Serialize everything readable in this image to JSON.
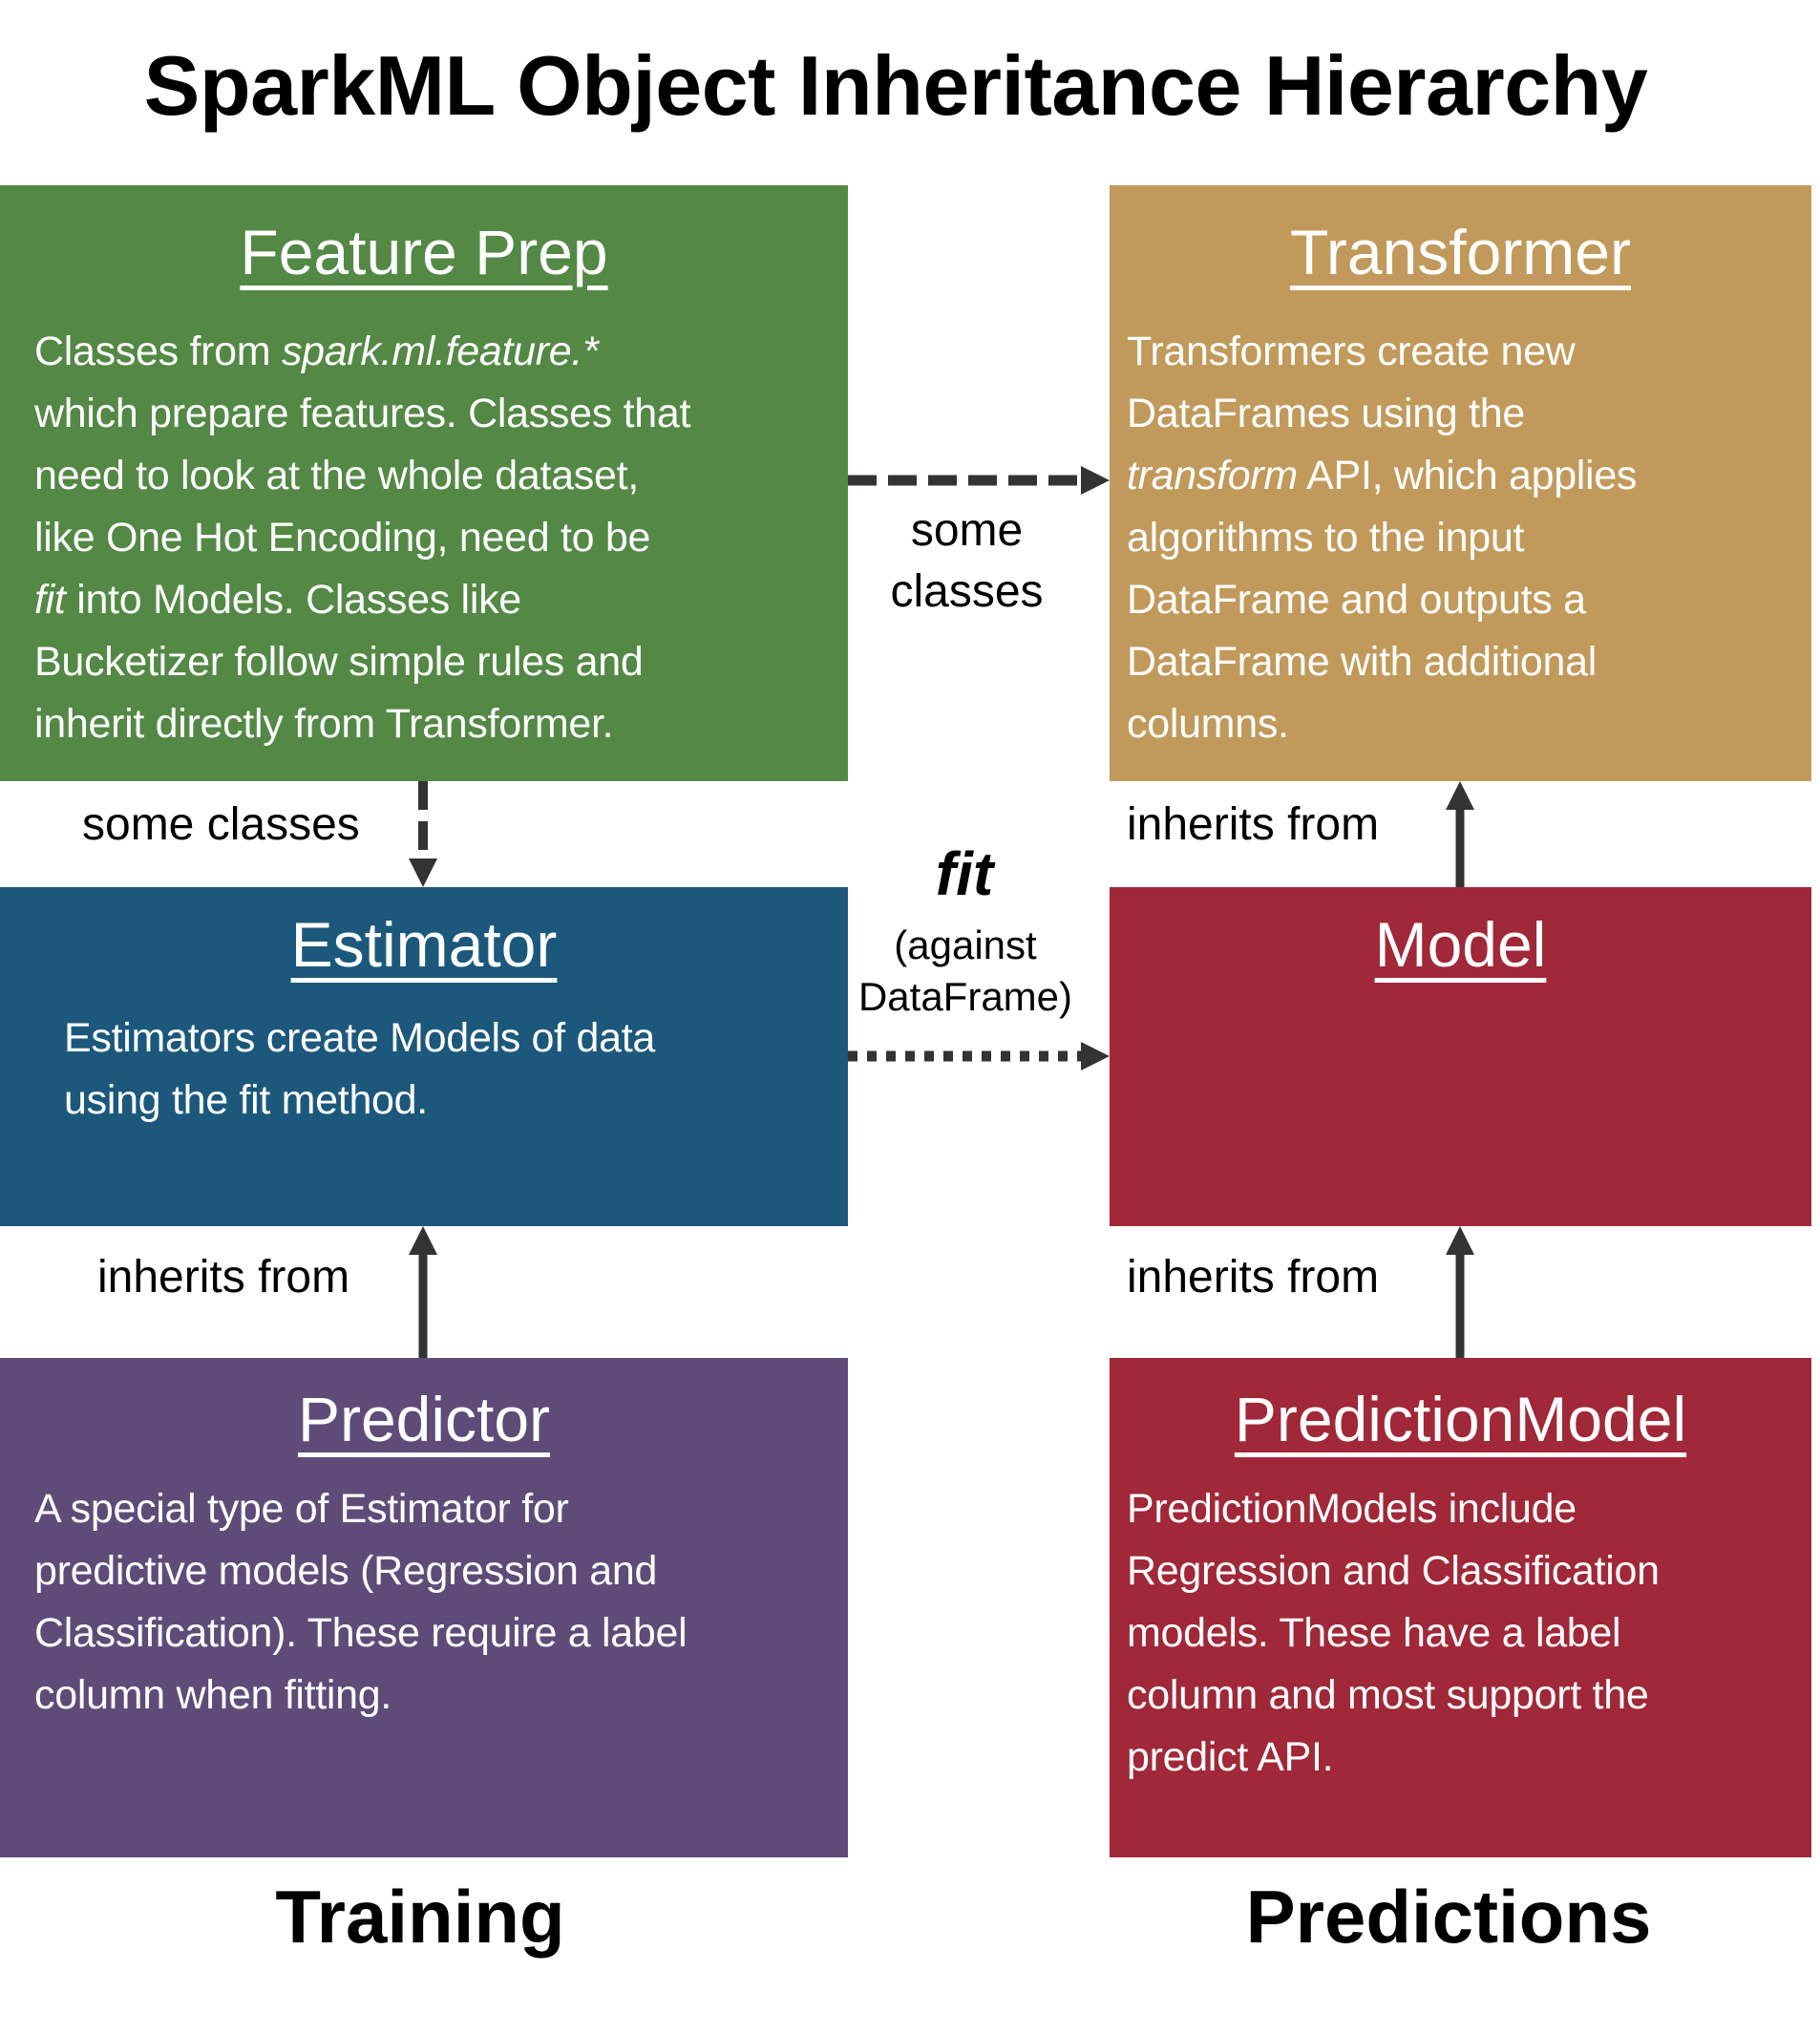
{
  "title": "SparkML Object Inheritance Hierarchy",
  "boxes": {
    "feature_prep": {
      "heading": "Feature Prep",
      "color": "#538845",
      "lines": [
        [
          {
            "t": "Classes from "
          },
          {
            "t": "spark.ml.feature.*",
            "i": true
          }
        ],
        [
          {
            "t": "which prepare features. Classes that"
          }
        ],
        [
          {
            "t": "need to look at the whole dataset,"
          }
        ],
        [
          {
            "t": "like One Hot Encoding, need to be"
          }
        ],
        [
          {
            "t": "fit",
            "i": true
          },
          {
            "t": " into Models. Classes like"
          }
        ],
        [
          {
            "t": "Bucketizer follow simple rules and"
          }
        ],
        [
          {
            "t": "inherit directly from Transformer."
          }
        ]
      ]
    },
    "transformer": {
      "heading": "Transformer",
      "color": "#c19a5b",
      "lines": [
        [
          {
            "t": "Transformers create new"
          }
        ],
        [
          {
            "t": "DataFrames using the"
          }
        ],
        [
          {
            "t": "transform",
            "i": true
          },
          {
            "t": " API, which applies"
          }
        ],
        [
          {
            "t": "algorithms to the input"
          }
        ],
        [
          {
            "t": "DataFrame and outputs a"
          }
        ],
        [
          {
            "t": "DataFrame with additional"
          }
        ],
        [
          {
            "t": "columns."
          }
        ]
      ]
    },
    "estimator": {
      "heading": "Estimator",
      "color": "#1c587c",
      "lines": [
        [
          {
            "t": "Estimators create Models of data"
          }
        ],
        [
          {
            "t": "using the fit method."
          }
        ]
      ]
    },
    "model": {
      "heading": "Model",
      "color": "#a02838",
      "lines": []
    },
    "predictor": {
      "heading": "Predictor",
      "color": "#5f4b78",
      "lines": [
        [
          {
            "t": "A special type of Estimator for"
          }
        ],
        [
          {
            "t": "predictive models (Regression and"
          }
        ],
        [
          {
            "t": "Classification). These require a label"
          }
        ],
        [
          {
            "t": "column when fitting."
          }
        ]
      ]
    },
    "prediction_model": {
      "heading": "PredictionModel",
      "color": "#a02838",
      "lines": [
        [
          {
            "t": "PredictionModels include"
          }
        ],
        [
          {
            "t": "Regression and Classification"
          }
        ],
        [
          {
            "t": "models. These have a label"
          }
        ],
        [
          {
            "t": "column and most support the"
          }
        ],
        [
          {
            "t": "predict API."
          }
        ]
      ]
    }
  },
  "connectors": {
    "featureprep_to_transformer": {
      "style": "dashed",
      "label_line1": "some",
      "label_line2": "classes"
    },
    "featureprep_to_estimator": {
      "style": "dashed",
      "label": "some classes"
    },
    "model_to_transformer": {
      "style": "solid",
      "label": "inherits from"
    },
    "estimator_to_model": {
      "style": "dotted",
      "label_fit": "fit",
      "label_line1": "(against",
      "label_line2": "DataFrame)"
    },
    "predictor_to_estimator": {
      "style": "solid",
      "label": "inherits from"
    },
    "predictionmodel_to_model": {
      "style": "solid",
      "label": "inherits from"
    }
  },
  "columns": {
    "left": "Training",
    "right": "Predictions"
  },
  "arrow_color": "#333333"
}
